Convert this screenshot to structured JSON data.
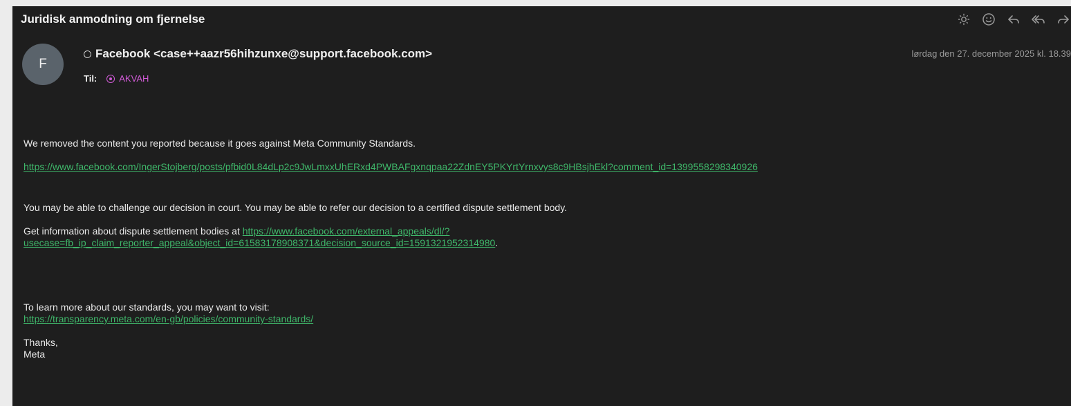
{
  "email": {
    "subject": "Juridisk anmodning om fjernelse",
    "avatar_letter": "F",
    "sender": "Facebook <case++aazr56hihzunxe@support.facebook.com>",
    "to_label": "Til:",
    "recipient": "AKVAH",
    "date": "lørdag den 27. december 2025 kl. 18.39"
  },
  "toolbar": {
    "icons": [
      "sun-icon",
      "emoji-icon",
      "reply-icon",
      "reply-all-icon",
      "forward-icon"
    ]
  },
  "body": {
    "p1": "We removed the content you reported because it goes against Meta Community Standards.",
    "link1": "https://www.facebook.com/IngerStojberg/posts/pfbid0L84dLp2c9JwLmxxUhERxd4PWBAFgxnqpaa22ZdnEY5PKYrtYrnxvys8c9HBsjhEkl?comment_id=1399558298340926",
    "p2": "You may be able to challenge our decision in court. You may be able to refer our decision to a certified dispute settlement body.",
    "p3_prefix": "Get information about dispute settlement bodies at ",
    "link2_line1": "https://www.facebook.com/external_appeals/dl/?",
    "link2_line2": "usecase=fb_ip_claim_reporter_appeal&object_id=61583178908371&decision_source_id=1591321952314980",
    "p3_suffix": ".",
    "p4": "To learn more about our standards, you may want to visit:",
    "link3": "https://transparency.meta.com/en-gb/policies/community-standards/",
    "thanks": "Thanks,",
    "signature": "Meta"
  },
  "colors": {
    "background": "#1e1e1e",
    "link": "#3fb76a",
    "recipient": "#d25bd8",
    "avatar": "#5a636b"
  }
}
